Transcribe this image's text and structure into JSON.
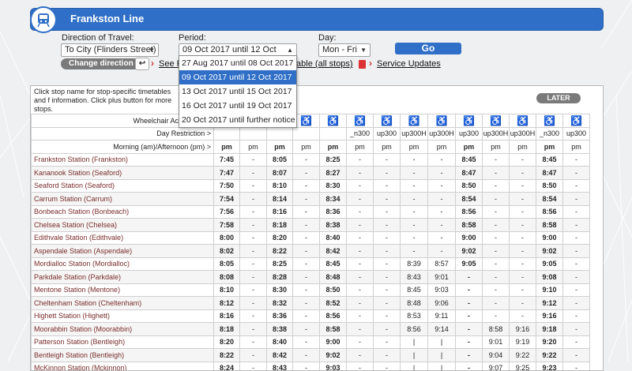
{
  "header": {
    "title": "Frankston Line",
    "icon": "train-icon"
  },
  "form": {
    "direction_label": "Direction of Travel:",
    "direction_value": "To City (Flinders Street)",
    "period_label": "Period:",
    "period_value": "09 Oct 2017 until 12 Oct 2017",
    "day_label": "Day:",
    "day_value": "Mon - Fri",
    "go_label": "Go",
    "change_direction_label": "Change direction",
    "see_link_prefix": "See R",
    "table_link": "table (all stops)",
    "service_updates": "Service Updates"
  },
  "period_options": [
    {
      "label": "27 Aug 2017 until 08 Oct 2017",
      "selected": false
    },
    {
      "label": "09 Oct 2017 until 12 Oct 2017",
      "selected": true
    },
    {
      "label": "13 Oct 2017 until 15 Oct 2017",
      "selected": false
    },
    {
      "label": "16 Oct 2017 until 19 Oct 2017",
      "selected": false
    },
    {
      "label": "20 Oct 2017 until further notice",
      "selected": false
    }
  ],
  "panel": {
    "info_text": "Click stop name for stop-specific timetables and f information. Click plus button for more stops.",
    "later_label": "LATER",
    "wheelchair_label": "Wheelchair Accessible S",
    "day_restriction_label": "Day Restriction >",
    "ampm_label": "Morning (am)/Afternoon (pm) >",
    "wheelchair_symbol": "♿",
    "day_restrictions": [
      "",
      "",
      "",
      "",
      "",
      "_n300",
      "up300",
      "up300H",
      "up300H",
      "up300",
      "up300H",
      "up300H",
      "_n300",
      "up300"
    ],
    "ampm": [
      "pm",
      "pm",
      "pm",
      "pm",
      "pm",
      "pm",
      "pm",
      "pm",
      "pm",
      "pm",
      "pm",
      "pm",
      "pm",
      "pm"
    ],
    "stops": [
      {
        "name": "Frankston Station (Frankston)",
        "times": [
          "7:45",
          "-",
          "8:05",
          "-",
          "8:25",
          "-",
          "-",
          "-",
          "-",
          "8:45",
          "-",
          "-",
          "8:45",
          "-"
        ]
      },
      {
        "name": "Kananook Station (Seaford)",
        "times": [
          "7:47",
          "-",
          "8:07",
          "-",
          "8:27",
          "-",
          "-",
          "-",
          "-",
          "8:47",
          "-",
          "-",
          "8:47",
          "-"
        ]
      },
      {
        "name": "Seaford Station (Seaford)",
        "times": [
          "7:50",
          "-",
          "8:10",
          "-",
          "8:30",
          "-",
          "-",
          "-",
          "-",
          "8:50",
          "-",
          "-",
          "8:50",
          "-"
        ]
      },
      {
        "name": "Carrum Station (Carrum)",
        "times": [
          "7:54",
          "-",
          "8:14",
          "-",
          "8:34",
          "-",
          "-",
          "-",
          "-",
          "8:54",
          "-",
          "-",
          "8:54",
          "-"
        ]
      },
      {
        "name": "Bonbeach Station (Bonbeach)",
        "times": [
          "7:56",
          "-",
          "8:16",
          "-",
          "8:36",
          "-",
          "-",
          "-",
          "-",
          "8:56",
          "-",
          "-",
          "8:56",
          "-"
        ]
      },
      {
        "name": "Chelsea Station (Chelsea)",
        "times": [
          "7:58",
          "-",
          "8:18",
          "-",
          "8:38",
          "-",
          "-",
          "-",
          "-",
          "8:58",
          "-",
          "-",
          "8:58",
          "-"
        ]
      },
      {
        "name": "Edithvale Station (Edithvale)",
        "times": [
          "8:00",
          "-",
          "8:20",
          "-",
          "8:40",
          "-",
          "-",
          "-",
          "-",
          "9:00",
          "-",
          "-",
          "9:00",
          "-"
        ]
      },
      {
        "name": "Aspendale Station (Aspendale)",
        "times": [
          "8:02",
          "-",
          "8:22",
          "-",
          "8:42",
          "-",
          "-",
          "-",
          "-",
          "9:02",
          "-",
          "-",
          "9:02",
          "-"
        ]
      },
      {
        "name": "Mordialloc Station (Mordialloc)",
        "times": [
          "8:05",
          "-",
          "8:25",
          "-",
          "8:45",
          "-",
          "-",
          "8:39",
          "8:57",
          "9:05",
          "-",
          "-",
          "9:05",
          "-"
        ]
      },
      {
        "name": "Parkdale Station (Parkdale)",
        "times": [
          "8:08",
          "-",
          "8:28",
          "-",
          "8:48",
          "-",
          "-",
          "8:43",
          "9:01",
          "-",
          "-",
          "-",
          "9:08",
          "-"
        ]
      },
      {
        "name": "Mentone Station (Mentone)",
        "times": [
          "8:10",
          "-",
          "8:30",
          "-",
          "8:50",
          "-",
          "-",
          "8:45",
          "9:03",
          "-",
          "-",
          "-",
          "9:10",
          "-"
        ]
      },
      {
        "name": "Cheltenham Station (Cheltenham)",
        "times": [
          "8:12",
          "-",
          "8:32",
          "-",
          "8:52",
          "-",
          "-",
          "8:48",
          "9:06",
          "-",
          "-",
          "-",
          "9:12",
          "-"
        ]
      },
      {
        "name": "Highett Station (Highett)",
        "times": [
          "8:16",
          "-",
          "8:36",
          "-",
          "8:56",
          "-",
          "-",
          "8:53",
          "9:11",
          "-",
          "-",
          "-",
          "9:16",
          "-"
        ]
      },
      {
        "name": "Moorabbin Station (Moorabbin)",
        "times": [
          "8:18",
          "-",
          "8:38",
          "-",
          "8:58",
          "-",
          "-",
          "8:56",
          "9:14",
          "-",
          "8:58",
          "9:16",
          "9:18",
          "-"
        ]
      },
      {
        "name": "Patterson Station (Bentleigh)",
        "times": [
          "8:20",
          "-",
          "8:40",
          "-",
          "9:00",
          "-",
          "-",
          "|",
          "|",
          "-",
          "9:01",
          "9:19",
          "9:20",
          "-"
        ]
      },
      {
        "name": "Bentleigh Station (Bentleigh)",
        "times": [
          "8:22",
          "-",
          "8:42",
          "-",
          "9:02",
          "-",
          "-",
          "|",
          "|",
          "-",
          "9:04",
          "9:22",
          "9:22",
          "-"
        ]
      },
      {
        "name": "McKinnon Station (Mckinnon)",
        "times": [
          "8:24",
          "-",
          "8:43",
          "-",
          "9:03",
          "-",
          "-",
          "|",
          "|",
          "-",
          "9:07",
          "9:25",
          "9:23",
          "-"
        ]
      }
    ]
  }
}
